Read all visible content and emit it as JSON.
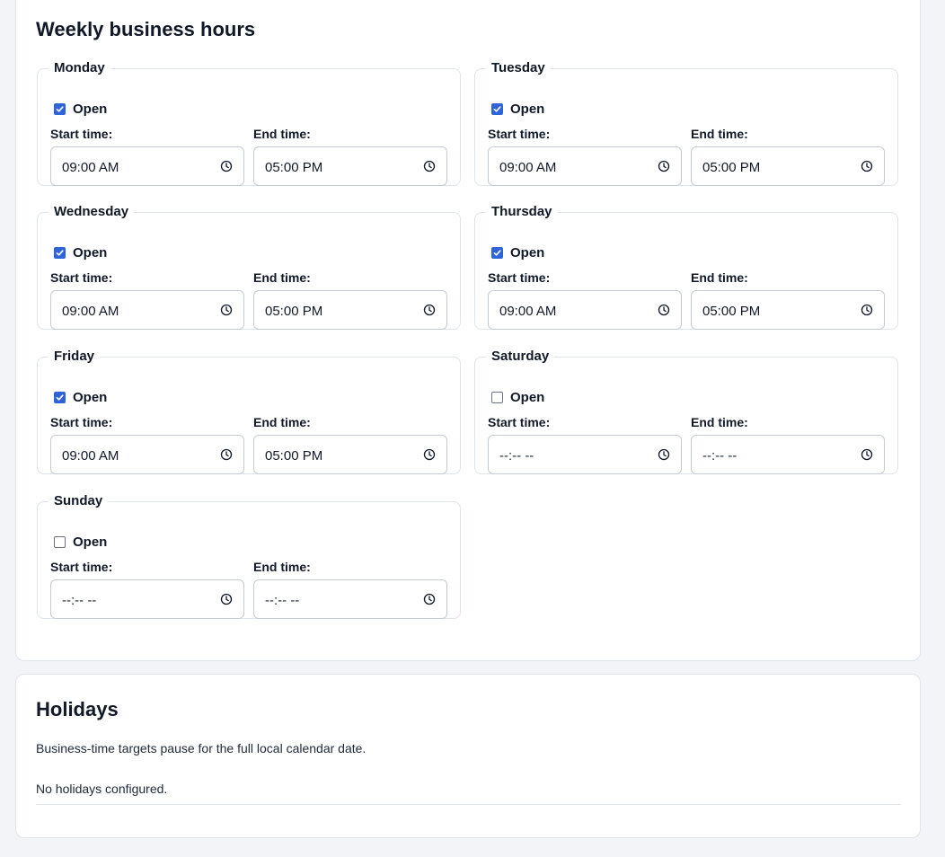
{
  "hours": {
    "title": "Weekly business hours",
    "open_label": "Open",
    "start_label": "Start time:",
    "end_label": "End time:",
    "days": [
      {
        "name": "Monday",
        "open": true,
        "start": "09:00 AM",
        "end": "05:00 PM"
      },
      {
        "name": "Tuesday",
        "open": true,
        "start": "09:00 AM",
        "end": "05:00 PM"
      },
      {
        "name": "Wednesday",
        "open": true,
        "start": "09:00 AM",
        "end": "05:00 PM"
      },
      {
        "name": "Thursday",
        "open": true,
        "start": "09:00 AM",
        "end": "05:00 PM"
      },
      {
        "name": "Friday",
        "open": true,
        "start": "09:00 AM",
        "end": "05:00 PM"
      },
      {
        "name": "Saturday",
        "open": false,
        "start": "--:-- --",
        "end": "--:-- --"
      },
      {
        "name": "Sunday",
        "open": false,
        "start": "--:-- --",
        "end": "--:-- --"
      }
    ]
  },
  "holidays": {
    "title": "Holidays",
    "description": "Business-time targets pause for the full local calendar date.",
    "empty_text": "No holidays configured."
  },
  "colors": {
    "accent": "#2f64d8",
    "border": "#dfe3ea",
    "background": "#f3f4f8"
  },
  "icons": {
    "time_input": "clock-icon",
    "checkbox": "checkmark-icon"
  }
}
